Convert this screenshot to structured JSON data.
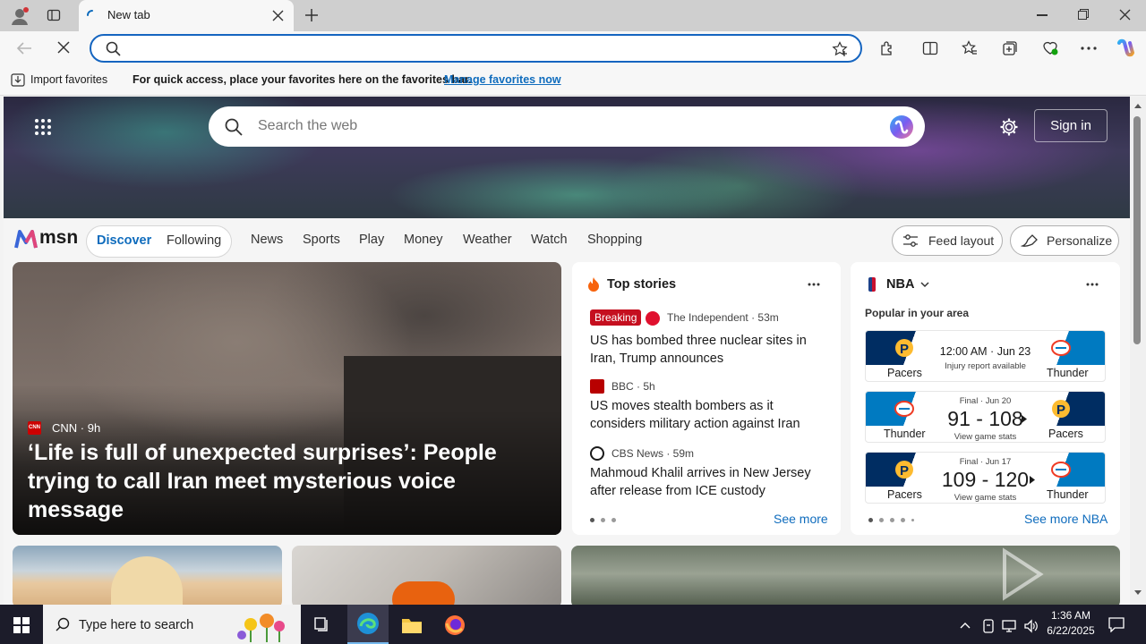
{
  "browser": {
    "tab_title": "New tab",
    "favorites_bar": {
      "import_label": "Import favorites",
      "prompt": "For quick access, place your favorites here on the favorites bar.",
      "manage_link": "Manage favorites now"
    }
  },
  "msn": {
    "search_placeholder": "Search the web",
    "sign_in": "Sign in",
    "logo_text": "msn",
    "nav": {
      "discover": "Discover",
      "following": "Following",
      "links": [
        "News",
        "Sports",
        "Play",
        "Money",
        "Weather",
        "Watch",
        "Shopping"
      ],
      "feed_layout": "Feed layout",
      "personalize": "Personalize"
    },
    "main_story": {
      "source": "CNN",
      "age": "9h",
      "logo_text": "CNN",
      "headline": "‘Life is full of unexpected surprises’: People trying to call Iran meet mysterious voice message"
    },
    "top_stories": {
      "title": "Top stories",
      "see_more": "See more",
      "items": [
        {
          "badge": "Breaking",
          "source": "The Independent · 53m",
          "headline": "US has bombed three nuclear sites in Iran, Trump announces"
        },
        {
          "source": "BBC · 5h",
          "headline": "US moves stealth bombers as it considers military action against Iran"
        },
        {
          "source": "CBS News · 59m",
          "headline": "Mahmoud Khalil arrives in New Jersey after release from ICE custody"
        }
      ]
    },
    "nba": {
      "title": "NBA",
      "subtitle": "Popular in your area",
      "see_more": "See more NBA",
      "games": [
        {
          "left_team": "Pacers",
          "right_team": "Thunder",
          "status": "12:00 AM · Jun 23",
          "note": "Injury report available",
          "score": ""
        },
        {
          "left_team": "Thunder",
          "right_team": "Pacers",
          "status": "Final · Jun 20",
          "note": "View game stats",
          "score": "91 - 108"
        },
        {
          "left_team": "Pacers",
          "right_team": "Thunder",
          "status": "Final · Jun 17",
          "note": "View game stats",
          "score": "109 - 120"
        }
      ]
    }
  },
  "taskbar": {
    "search_placeholder": "Type here to search",
    "time": "1:36 AM",
    "date": "6/22/2025"
  },
  "colors": {
    "accent": "#0f6cbd",
    "pacers_navy": "#002d62",
    "pacers_gold": "#fdbb30",
    "thunder_blue": "#007ac1",
    "breaking_red": "#c50f1f"
  }
}
